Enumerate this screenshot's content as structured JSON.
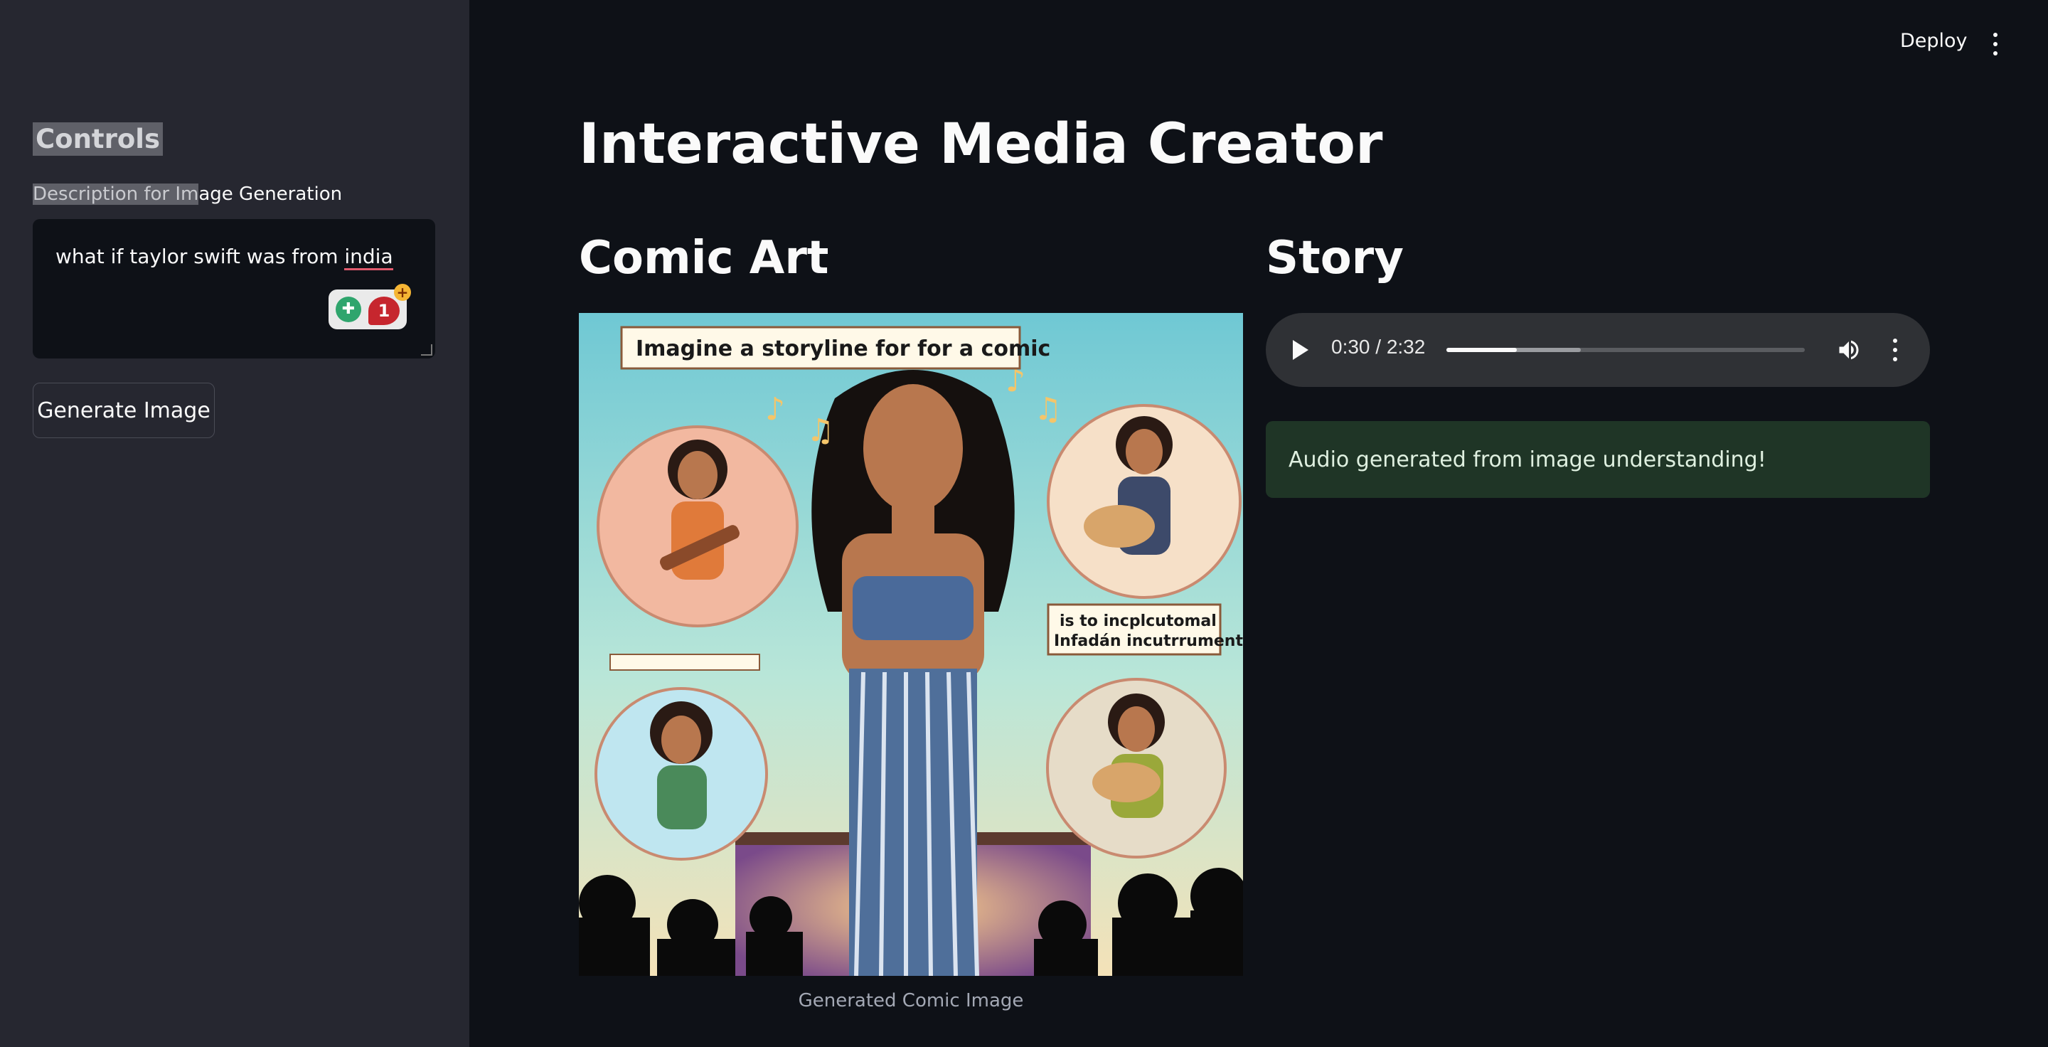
{
  "sidebar": {
    "title": "Controls",
    "label_highlighted": "Description for Im",
    "label_rest": "age Generation",
    "textarea_value_prefix": "what if taylor swift was from ",
    "textarea_value_misspelled": "india",
    "extension_badge_count": "1",
    "generate_button": "Generate Image"
  },
  "header": {
    "deploy_label": "Deploy"
  },
  "main": {
    "title": "Interactive Media Creator",
    "comic_heading": "Comic Art",
    "story_heading": "Story",
    "comic_caption": "Generated Comic Image",
    "comic_bubble_top": "Imagine a storyline for for a comic",
    "comic_bubble_right_1": "is to incplcutomal",
    "comic_bubble_right_2": "Infadán incutrruments"
  },
  "audio": {
    "time_label": "0:30 / 2:32",
    "progress_fraction": 0.197,
    "buffered_fraction": 0.375
  },
  "status": {
    "success_message": "Audio generated from image understanding!"
  },
  "colors": {
    "app_bg": "#0e1117",
    "sidebar_bg": "#262730",
    "success_bg": "#1f3526",
    "audio_bg": "#2f3135"
  }
}
